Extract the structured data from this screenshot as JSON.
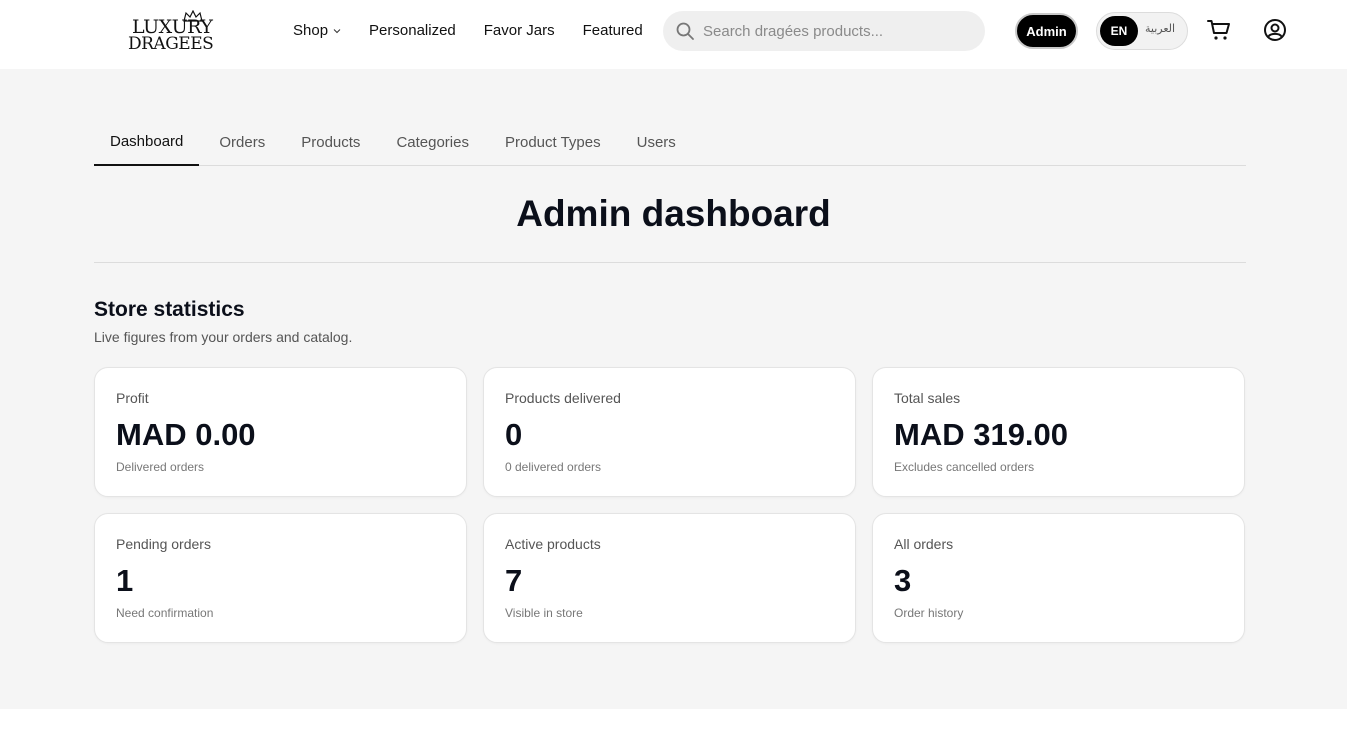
{
  "header": {
    "logo_line1": "LUXURY",
    "logo_line2": "DRAGEES",
    "nav": [
      {
        "label": "Shop",
        "has_dropdown": true
      },
      {
        "label": "Personalized"
      },
      {
        "label": "Favor Jars"
      },
      {
        "label": "Featured"
      }
    ],
    "search_placeholder": "Search dragées products...",
    "admin_label": "Admin",
    "lang_active": "EN",
    "lang_other": "العربية"
  },
  "tabs": [
    {
      "label": "Dashboard",
      "active": true
    },
    {
      "label": "Orders"
    },
    {
      "label": "Products"
    },
    {
      "label": "Categories"
    },
    {
      "label": "Product Types"
    },
    {
      "label": "Users"
    }
  ],
  "page_title": "Admin dashboard",
  "stats": {
    "title": "Store statistics",
    "subtitle": "Live figures from your orders and catalog.",
    "cards": [
      {
        "label": "Profit",
        "value": "MAD 0.00",
        "note": "Delivered orders"
      },
      {
        "label": "Products delivered",
        "value": "0",
        "note": "0 delivered orders"
      },
      {
        "label": "Total sales",
        "value": "MAD 319.00",
        "note": "Excludes cancelled orders"
      },
      {
        "label": "Pending orders",
        "value": "1",
        "note": "Need confirmation"
      },
      {
        "label": "Active products",
        "value": "7",
        "note": "Visible in store"
      },
      {
        "label": "All orders",
        "value": "3",
        "note": "Order history"
      }
    ]
  },
  "colors": {
    "accent": "#000000",
    "background": "#f5f5f5",
    "card": "#ffffff"
  },
  "icons": [
    "crown-icon",
    "chevron-down-icon",
    "search-icon",
    "cart-icon",
    "user-circle-icon"
  ]
}
